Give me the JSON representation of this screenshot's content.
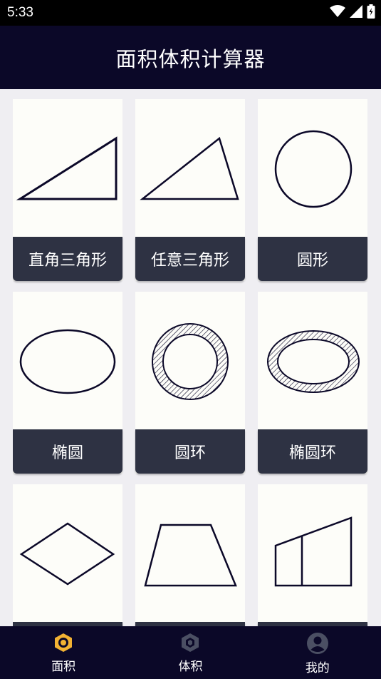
{
  "status": {
    "time": "5:33"
  },
  "header": {
    "title": "面积体积计算器"
  },
  "shapes": [
    {
      "label": "直角三角形",
      "icon": "right-triangle-icon"
    },
    {
      "label": "任意三角形",
      "icon": "triangle-icon"
    },
    {
      "label": "圆形",
      "icon": "circle-icon"
    },
    {
      "label": "椭圆",
      "icon": "ellipse-icon"
    },
    {
      "label": "圆环",
      "icon": "ring-icon"
    },
    {
      "label": "椭圆环",
      "icon": "elliptical-ring-icon"
    },
    {
      "label": "",
      "icon": "rhombus-icon"
    },
    {
      "label": "",
      "icon": "trapezoid-icon"
    },
    {
      "label": "",
      "icon": "quadrilateral-icon"
    }
  ],
  "nav": [
    {
      "label": "面积",
      "icon": "hexagon-icon",
      "active": true
    },
    {
      "label": "体积",
      "icon": "cube-icon",
      "active": false
    },
    {
      "label": "我的",
      "icon": "user-icon",
      "active": false
    }
  ],
  "colors": {
    "accent": "#f2b233",
    "header_bg": "#0b0828",
    "label_bg": "#2e3243"
  }
}
